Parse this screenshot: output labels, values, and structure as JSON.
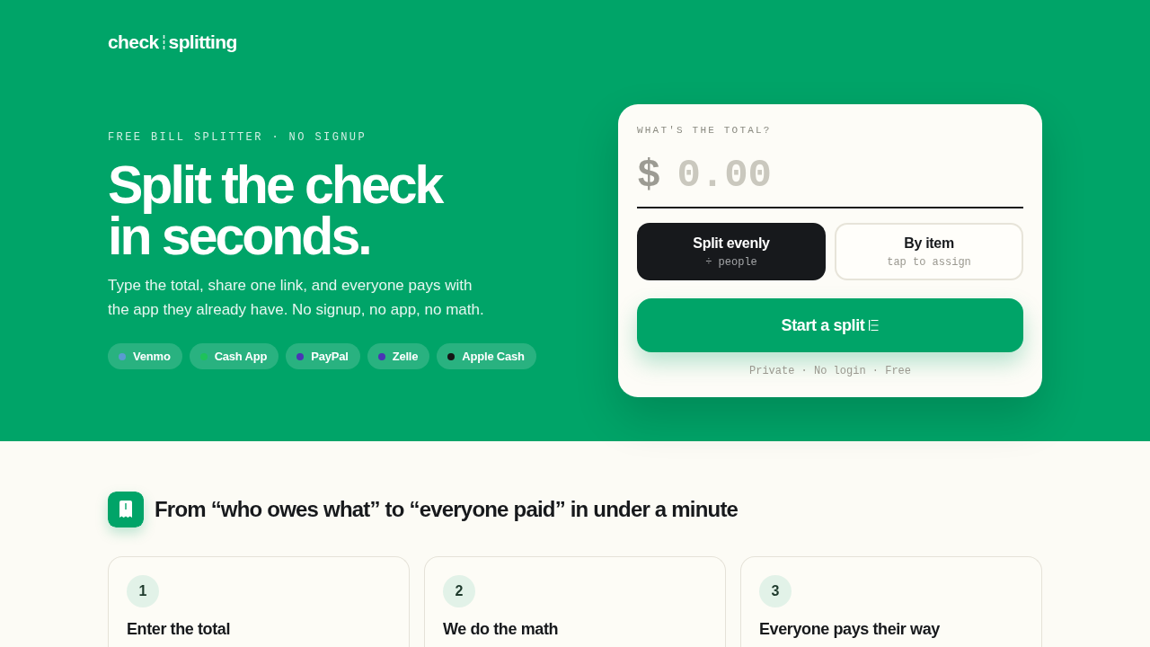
{
  "brand": {
    "word_1": "check",
    "word_2": "splitting"
  },
  "hero": {
    "eyebrow": "FREE BILL SPLITTER · NO SIGNUP",
    "headline_lines": [
      "Split the check",
      "in seconds."
    ],
    "subtitle": "Type the total, share one link, and everyone pays with the app they already have. No signup, no app, no math.",
    "payment_apps": [
      {
        "label": "Venmo",
        "color": "#5a9bd0"
      },
      {
        "label": "Cash App",
        "color": "#1ec25a"
      },
      {
        "label": "PayPal",
        "color": "#4a35b5"
      },
      {
        "label": "Zelle",
        "color": "#4a35b5"
      },
      {
        "label": "Apple Cash",
        "color": "#151515"
      }
    ]
  },
  "split_card": {
    "label": "WHAT'S THE TOTAL?",
    "currency": "$",
    "amount": {
      "placeholder": "0.00"
    },
    "modes": [
      {
        "label": "Split evenly",
        "hint": "÷ people",
        "selected": true
      },
      {
        "label": "By item",
        "hint": "tap to assign",
        "selected": false
      }
    ],
    "start_button": "Start a split",
    "note": "Private · No login · Free"
  },
  "how_it_works": {
    "heading": "From “who owes what” to “everyone paid” in under a minute",
    "steps": [
      {
        "number": "1",
        "title": "Enter the total"
      },
      {
        "number": "2",
        "title": "We do the math"
      },
      {
        "number": "3",
        "title": "Everyone pays their way"
      }
    ]
  }
}
